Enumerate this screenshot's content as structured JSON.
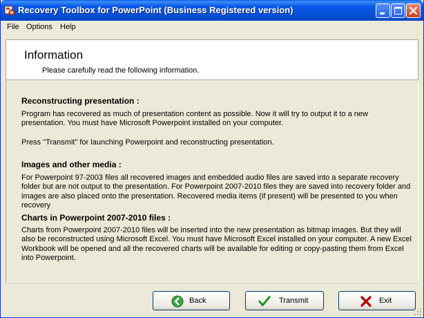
{
  "window": {
    "title": "Recovery Toolbox for PowerPoint (Business Registered version)"
  },
  "menu": {
    "items": [
      "File",
      "Options",
      "Help"
    ]
  },
  "header": {
    "title": "Information",
    "subtitle": "Please carefully read the following information."
  },
  "sections": [
    {
      "heading": "Reconstructing presentation :",
      "paragraphs": [
        "Program has recovered as much of presentation content as possible. Now it will try to output it to a new presentation. You must have Microsoft Powerpoint installed on your computer.",
        "Press \"Transmit\" for launching Powerpoint and reconstructing presentation."
      ]
    },
    {
      "heading": "Images and other media :",
      "paragraphs": [
        "For Powerpoint 97-2003 files all recovered images and embedded audio files are saved into a separate recovery folder but are not output to the presentation. For Powerpoint 2007-2010 files they are saved into recovery folder and images are also placed onto the presentation. Recovered media items (if present) will be presented to you when recovery"
      ]
    },
    {
      "heading": "Charts in Powerpoint 2007-2010 files :",
      "paragraphs": [
        "Charts from Powerpoint 2007-2010 files will be inserted into the new presentation as bitmap images. But they will also be reconstructed using Microsoft Excel. You must have Microsoft Excel installed on your computer. A new Excel Workbook will be opened and all the recovered charts will be available for editing or copy-pasting them from Excel into Powerpoint."
      ]
    }
  ],
  "buttons": {
    "back": "Back",
    "transmit": "Transmit",
    "exit": "Exit"
  },
  "icons": {
    "back": "arrow-left-icon",
    "transmit": "checkmark-icon",
    "exit": "cross-icon"
  },
  "colors": {
    "titlebar": "#0558e0",
    "back_icon": "#2f9e2f",
    "transmit_icon": "#1f8f1f",
    "exit_icon": "#b01010"
  }
}
